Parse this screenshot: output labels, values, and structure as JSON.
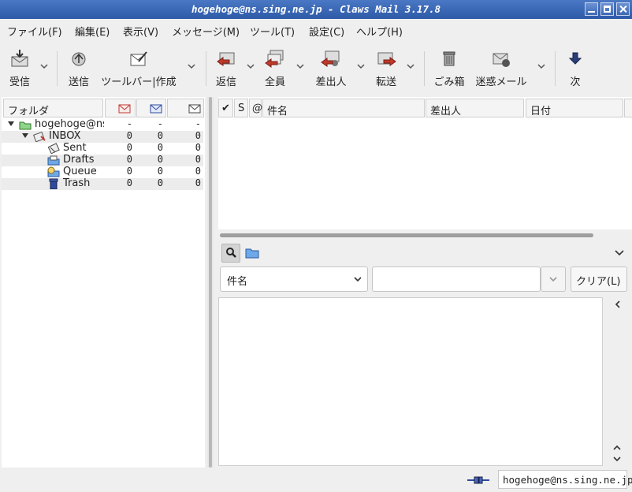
{
  "window": {
    "title": "hogehoge@ns.sing.ne.jp - Claws Mail 3.17.8"
  },
  "menu": [
    "ファイル(F)",
    "編集(E)",
    "表示(V)",
    "メッセージ(M)",
    "ツール(T)",
    "設定(C)",
    "ヘルプ(H)"
  ],
  "toolbar": {
    "receive": "受信",
    "send": "送信",
    "compose": "ツールバー|作成",
    "reply": "返信",
    "reply_all": "全員",
    "reply_sender": "差出人",
    "forward": "転送",
    "trash": "ごみ箱",
    "junk": "迷惑メール",
    "next": "次"
  },
  "folder_pane": {
    "header": "フォルダ",
    "account": {
      "name": "hogehoge@ns",
      "new": "-",
      "unread": "-",
      "total": "-"
    },
    "folders": [
      {
        "name": "INBOX",
        "new": "0",
        "unread": "0",
        "total": "0"
      },
      {
        "name": "Sent",
        "new": "0",
        "unread": "0",
        "total": "0"
      },
      {
        "name": "Drafts",
        "new": "0",
        "unread": "0",
        "total": "0"
      },
      {
        "name": "Queue",
        "new": "0",
        "unread": "0",
        "total": "0"
      },
      {
        "name": "Trash",
        "new": "0",
        "unread": "0",
        "total": "0"
      }
    ]
  },
  "message_list": {
    "columns": {
      "mark": "✔",
      "status": "S",
      "attach": "@",
      "subject": "件名",
      "from": "差出人",
      "date": "日付"
    }
  },
  "quick_search": {
    "field": "件名",
    "value": "",
    "clear_label": "クリア(L)"
  },
  "status": {
    "account": "hogehoge@ns.sing.ne.jp"
  },
  "colors": {
    "titlebar": "#2e5aa8",
    "folder_icon": "#3a7ad6",
    "account_icon": "#4aa84a"
  }
}
